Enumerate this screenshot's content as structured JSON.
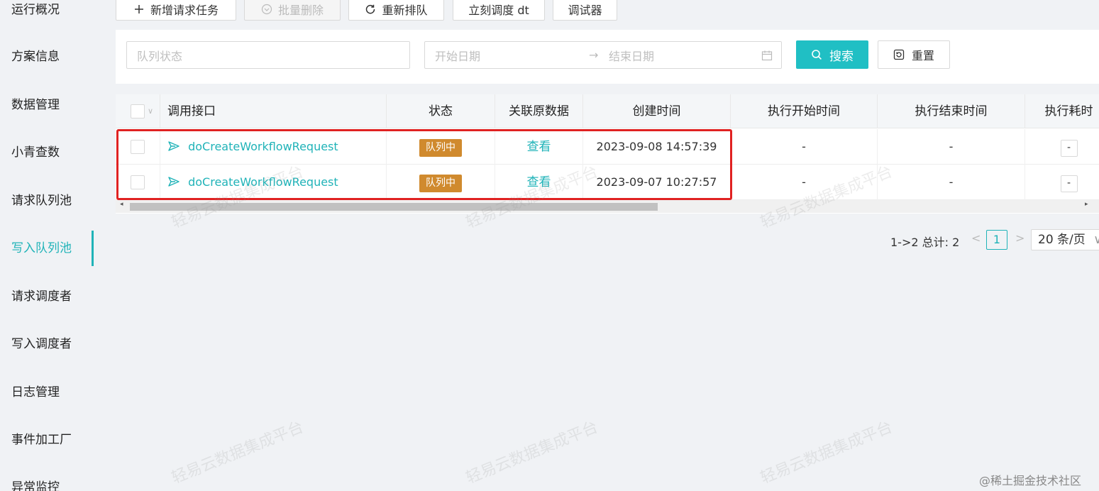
{
  "sidebar": {
    "items": [
      {
        "label": "运行概况"
      },
      {
        "label": "方案信息"
      },
      {
        "label": "数据管理"
      },
      {
        "label": "小青查数"
      },
      {
        "label": "请求队列池"
      },
      {
        "label": "写入队列池"
      },
      {
        "label": "请求调度者"
      },
      {
        "label": "写入调度者"
      },
      {
        "label": "日志管理"
      },
      {
        "label": "事件加工厂"
      },
      {
        "label": "异常监控"
      }
    ],
    "active": "写入队列池"
  },
  "toolbar": {
    "add_label": "新增请求任务",
    "batch_delete_label": "批量删除",
    "requeue_label": "重新排队",
    "dispatch_label": "立刻调度 dt",
    "debugger_label": "调试器"
  },
  "search": {
    "queue_status_placeholder": "队列状态",
    "start_date_placeholder": "开始日期",
    "end_date_placeholder": "结束日期",
    "search_label": "搜索",
    "reset_label": "重置"
  },
  "table": {
    "columns": [
      "调用接口",
      "状态",
      "关联原数据",
      "创建时间",
      "执行开始时间",
      "执行结束时间",
      "执行耗时"
    ],
    "rows": [
      {
        "api": "doCreateWorkflowRequest",
        "status": "队列中",
        "link": "查看",
        "created": "2023-09-08 14:57:39",
        "start": "-",
        "end": "-",
        "duration": "-"
      },
      {
        "api": "doCreateWorkflowRequest",
        "status": "队列中",
        "link": "查看",
        "created": "2023-09-07 10:27:57",
        "start": "-",
        "end": "-",
        "duration": "-"
      }
    ]
  },
  "pagination": {
    "total_text": "1->2 总计: 2",
    "current_page": "1",
    "page_size": "20 条/页"
  },
  "watermark": "轻易云数据集成平台",
  "footer_mark": "@稀土掘金技术社区",
  "colors": {
    "accent": "#20b3b8",
    "badge": "#d08a2e",
    "highlight": "#e02222"
  }
}
